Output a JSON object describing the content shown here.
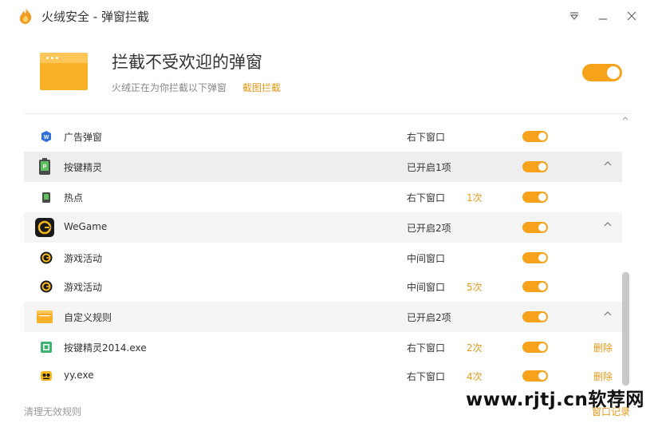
{
  "window": {
    "title": "火绒安全 - 弹窗拦截",
    "menu_icon": "dropdown-triangle-icon",
    "minimize_icon": "minimize-icon",
    "close_icon": "close-icon"
  },
  "header": {
    "title": "拦截不受欢迎的弹窗",
    "subtitle": "火绒正在为你拦截以下弹窗",
    "link": "截图拦截",
    "master_toggle_on": true
  },
  "rows": [
    {
      "icon": "wps-icon",
      "name": "广告弹窗",
      "position": "右下窗口",
      "count": "",
      "on": true,
      "type": "item"
    },
    {
      "icon": "anjian-icon",
      "name": "按键精灵",
      "position": "已开启1项",
      "count": "",
      "on": true,
      "type": "group"
    },
    {
      "icon": "anjian-small-icon",
      "name": "热点",
      "position": "右下窗口",
      "count": "1次",
      "on": true,
      "type": "item"
    },
    {
      "icon": "wegame-icon",
      "name": "WeGame",
      "position": "已开启2项",
      "count": "",
      "on": true,
      "type": "group"
    },
    {
      "icon": "wegame-small-icon",
      "name": "游戏活动",
      "position": "中间窗口",
      "count": "",
      "on": true,
      "type": "item"
    },
    {
      "icon": "wegame-small-icon",
      "name": "游戏活动",
      "position": "中间窗口",
      "count": "5次",
      "on": true,
      "type": "item"
    },
    {
      "icon": "custom-rule-icon",
      "name": "自定义规则",
      "position": "已开启2项",
      "count": "",
      "on": true,
      "type": "group"
    },
    {
      "icon": "exe-icon",
      "name": "按键精灵2014.exe",
      "position": "右下窗口",
      "count": "2次",
      "on": true,
      "type": "item",
      "delete": "删除"
    },
    {
      "icon": "yy-icon",
      "name": "yy.exe",
      "position": "右下窗口",
      "count": "4次",
      "on": true,
      "type": "item",
      "delete": "删除"
    }
  ],
  "footer": {
    "left": "清理无效规则",
    "right": "窗口记录"
  },
  "watermark": "www.rjtj.cn软荐网",
  "colors": {
    "accent": "#f7a21b",
    "link": "#e59a1a",
    "group_bg": "#f5f5f5"
  }
}
